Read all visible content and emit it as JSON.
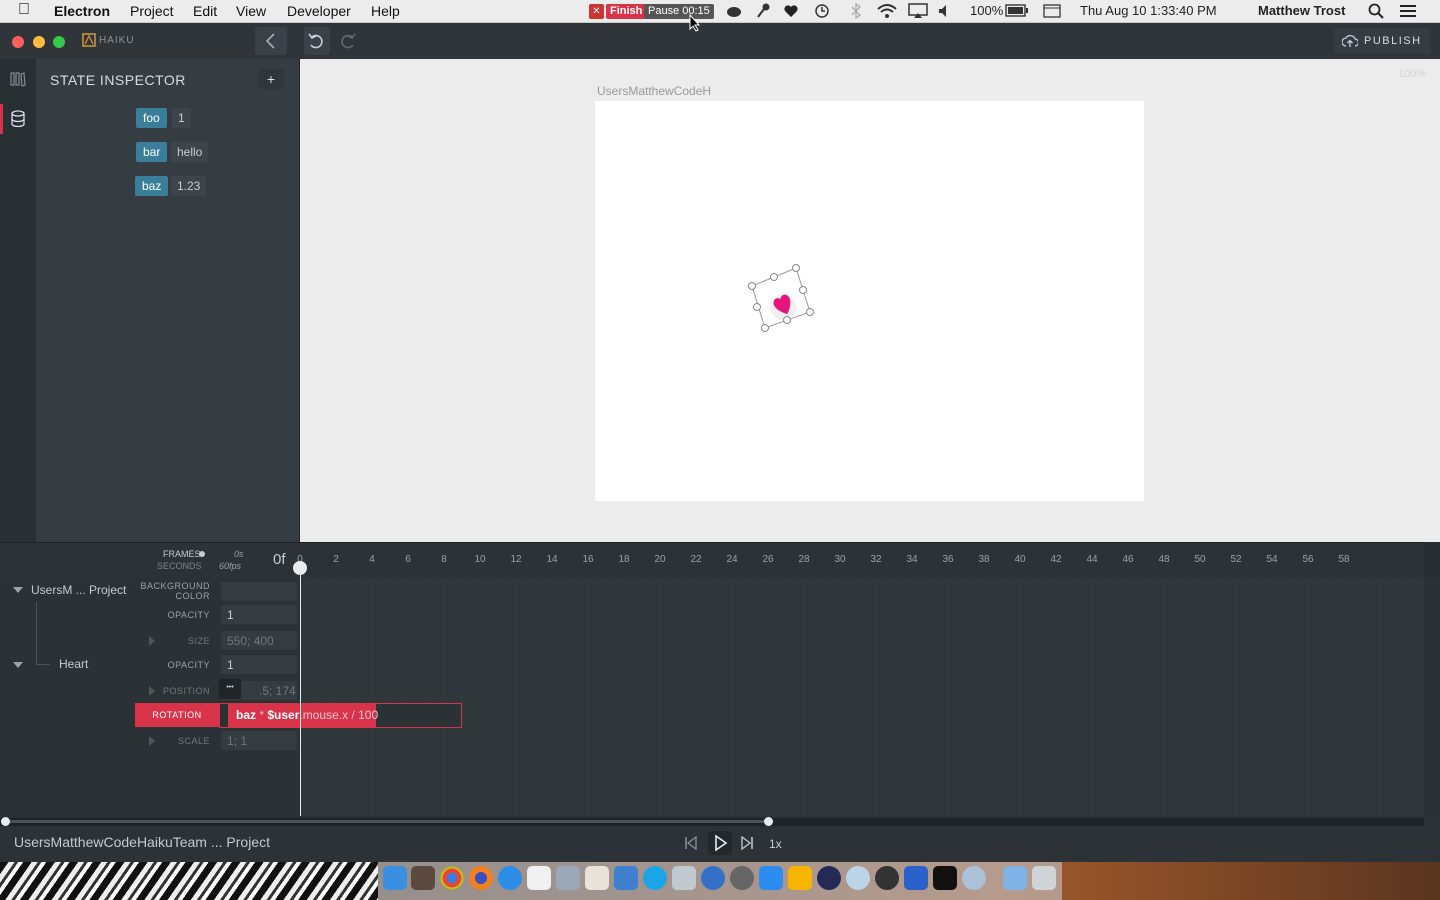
{
  "menubar": {
    "app_name": "Electron",
    "menus": [
      "Project",
      "Edit",
      "View",
      "Developer",
      "Help"
    ],
    "recorder": {
      "finish_label": "Finish",
      "pause_label": "Pause 00:15",
      "close_glyph": "✕"
    },
    "battery": "100%",
    "datetime": "Thu Aug 10  1:33:40 PM",
    "user": "Matthew Trost"
  },
  "titlebar": {
    "brand": "HAIKU",
    "publish_label": "PUBLISH"
  },
  "inspector": {
    "title": "STATE INSPECTOR",
    "add_glyph": "+",
    "states": [
      {
        "key": "foo",
        "value": "1"
      },
      {
        "key": "bar",
        "value": "hello"
      },
      {
        "key": "baz",
        "value": "1.23"
      }
    ]
  },
  "stage": {
    "artboard_title": "UsersMatthewCodeH",
    "zoom": "100%",
    "heart_color": "#e6157a"
  },
  "timeline": {
    "frames_label": "FRAMES",
    "seconds_label": "SECONDS",
    "time_seconds": "0s",
    "fps": "60fps",
    "current_frame": "0f",
    "ticks": [
      "0",
      "2",
      "4",
      "6",
      "8",
      "10",
      "12",
      "14",
      "16",
      "18",
      "20",
      "22",
      "24",
      "26",
      "28",
      "30",
      "32",
      "34",
      "36",
      "38",
      "40",
      "42",
      "44",
      "46",
      "48",
      "50",
      "52",
      "54",
      "56",
      "58"
    ],
    "tree": {
      "root_label": "UsersM ... Project",
      "child_label": "Heart"
    },
    "props": {
      "background_color_label": "BACKGROUND COLOR",
      "opacity_label": "OPACITY",
      "opacity_value": "1",
      "size_label": "SIZE",
      "size_value": "550; 400",
      "heart_opacity_label": "OPACITY",
      "heart_opacity_value": "1",
      "position_label": "POSITION",
      "position_value": ".5; 174",
      "rotation_label": "ROTATION",
      "rotation_expr": {
        "p1": "baz",
        "p2": " * ",
        "p3": "$user",
        "p4": ".mouse.x",
        "p5": " / ",
        "p6": "100"
      },
      "scale_label": "SCALE",
      "scale_value": "1; 1",
      "ellipsis": "•••"
    },
    "footer_project": "UsersMatthewCodeHaikuTeam ... Project",
    "playback_speed": "1x"
  },
  "colors": {
    "accent_pink": "#d9334a",
    "state_blue": "#3a7e99"
  }
}
